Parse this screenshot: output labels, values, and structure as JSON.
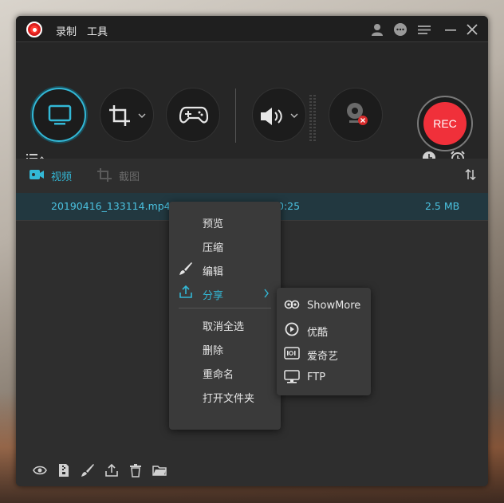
{
  "menu": {
    "record": "录制",
    "tools": "工具"
  },
  "record_button": {
    "label": "REC"
  },
  "tabs": {
    "video": "视频",
    "screenshot": "截图"
  },
  "file": {
    "name": "20190416_133114.mp4",
    "duration": "0:25",
    "size": "2.5 MB"
  },
  "context_menu": {
    "preview": "预览",
    "compress": "压缩",
    "edit": "编辑",
    "share": "分享",
    "deselect_all": "取消全选",
    "delete": "删除",
    "rename": "重命名",
    "open_folder": "打开文件夹"
  },
  "share_menu": {
    "showmore": "ShowMore",
    "youku": "优酷",
    "iqiyi": "爱奇艺",
    "ftp": "FTP"
  },
  "colors": {
    "accent": "#33b8d6",
    "rec": "#f0303a",
    "window": "#2b2b2b"
  }
}
